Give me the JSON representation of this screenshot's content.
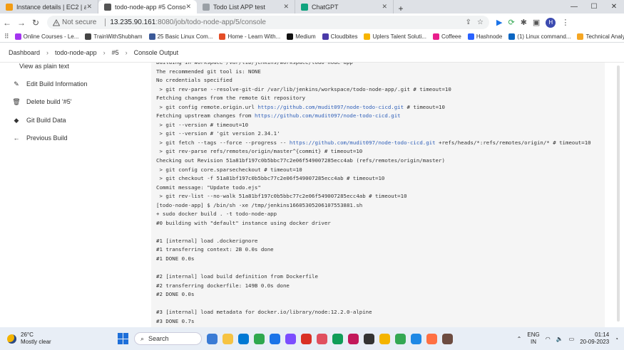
{
  "tabs": [
    {
      "label": "Instance details | EC2 | ap-south",
      "color": "#f39c12"
    },
    {
      "label": "todo-node-app #5 Console [Jenki",
      "color": "#555555",
      "active": true
    },
    {
      "label": "Todo List APP test",
      "color": "#9aa0a6"
    },
    {
      "label": "ChatGPT",
      "color": "#10a37f"
    }
  ],
  "window_controls": {
    "minimize": "—",
    "maximize": "☐",
    "close": "✕"
  },
  "toolbar": {
    "back": "←",
    "forward": "→",
    "reload": "↻",
    "not_secure": "Not secure",
    "url_host": "13.235.90.161",
    "url_path": ":8080/job/todo-node-app/5/console"
  },
  "bookmarks": [
    {
      "label": "Online Courses - Le...",
      "color": "#a435f0"
    },
    {
      "label": "TrainWithShubham",
      "color": "#444444"
    },
    {
      "label": "25 Basic Linux Com...",
      "color": "#3b5998"
    },
    {
      "label": "Home - Learn With...",
      "color": "#e44d26"
    },
    {
      "label": "Medium",
      "color": "#111111"
    },
    {
      "label": "Cloudbites",
      "color": "#4a3aa8"
    },
    {
      "label": "Uplers Talent Soluti...",
      "color": "#f7b500"
    },
    {
      "label": "Coffeee",
      "color": "#e91e8c"
    },
    {
      "label": "Hashnode",
      "color": "#2962ff"
    },
    {
      "label": "(1) Linux command...",
      "color": "#0a66c2"
    },
    {
      "label": "Technical Analysis...",
      "color": "#f5a623"
    }
  ],
  "breadcrumb": [
    "Dashboard",
    "todo-node-app",
    "#5",
    "Console Output"
  ],
  "sidebar": [
    {
      "label": "View as plain text",
      "icon": "document-icon",
      "glyph": "▤"
    },
    {
      "label": "Edit Build Information",
      "icon": "edit-icon",
      "glyph": "✎"
    },
    {
      "label": "Delete build '#5'",
      "icon": "trash-icon",
      "glyph": "🗑"
    },
    {
      "label": "Git Build Data",
      "icon": "git-icon",
      "glyph": "◆"
    },
    {
      "label": "Previous Build",
      "icon": "arrow-left-icon",
      "glyph": "←"
    }
  ],
  "console_lines": [
    "Building in workspace /var/lib/jenkins/workspace/todo-node-app",
    "The recommended git tool is: NONE",
    "No credentials specified",
    " > git rev-parse --resolve-git-dir /var/lib/jenkins/workspace/todo-node-app/.git # timeout=10",
    "Fetching changes from the remote Git repository",
    " > git config remote.origin.url {{link}} # timeout=10",
    "Fetching upstream changes from {{link}}",
    " > git --version # timeout=10",
    " > git --version # 'git version 2.34.1'",
    " > git fetch --tags --force --progress -- {{link}} +refs/heads/*:refs/remotes/origin/* # timeout=10",
    " > git rev-parse refs/remotes/origin/master^{commit} # timeout=10",
    "Checking out Revision 51a81bf197c0b5bbc77c2e06f549007285ecc4ab (refs/remotes/origin/master)",
    " > git config core.sparsecheckout # timeout=10",
    " > git checkout -f 51a81bf197c0b5bbc77c2e06f549007285ecc4ab # timeout=10",
    "Commit message: \"Update todo.ejs\"",
    " > git rev-list --no-walk 51a81bf197c0b5bbc77c2e06f549007285ecc4ab # timeout=10",
    "[todo-node-app] $ /bin/sh -xe /tmp/jenkins16605305206107553881.sh",
    "+ sudo docker build . -t todo-node-app",
    "#0 building with \"default\" instance using docker driver",
    "",
    "#1 [internal] load .dockerignore",
    "#1 transferring context: 2B 0.0s done",
    "#1 DONE 0.0s",
    "",
    "#2 [internal] load build definition from Dockerfile",
    "#2 transferring dockerfile: 149B 0.0s done",
    "#2 DONE 0.0s",
    "",
    "#3 [internal] load metadata for docker.io/library/node:12.2.0-alpine",
    "#3 DONE 0.7s"
  ],
  "repo_link": "https://github.com/mudit097/node-todo-cicd.git",
  "taskbar": {
    "temperature": "26°C",
    "weather": "Mostly clear",
    "search_label": "Search",
    "lang_top": "ENG",
    "lang_bottom": "IN",
    "time": "01:14",
    "date": "20-09-2023",
    "apps": [
      "#3a7bd5",
      "#f6c343",
      "#0078d4",
      "#2fa84f",
      "#1a73e8",
      "#7b4dff",
      "#d93025",
      "#e04f5f",
      "#0f9d58",
      "#c2185b",
      "#333333",
      "#f4b400",
      "#34a853",
      "#1e88e5",
      "#ff7043",
      "#6d4c41"
    ]
  }
}
